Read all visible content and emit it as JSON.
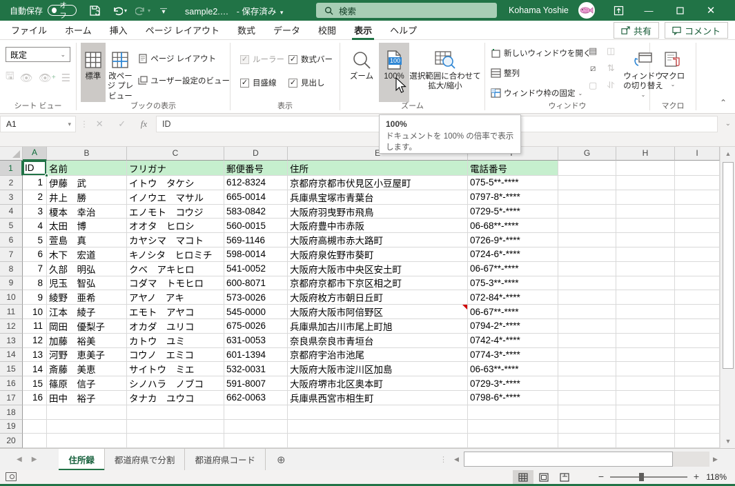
{
  "titlebar": {
    "autosave_label": "自動保存",
    "autosave_state": "オフ",
    "document_title": "sample2.…",
    "save_status": "- 保存済み",
    "search_placeholder": "検索",
    "user_name": "Kohama Yoshie"
  },
  "ribbon_tabs": {
    "items": [
      {
        "label": "ファイル"
      },
      {
        "label": "ホーム"
      },
      {
        "label": "挿入"
      },
      {
        "label": "ページ レイアウト"
      },
      {
        "label": "数式"
      },
      {
        "label": "データ"
      },
      {
        "label": "校閲"
      },
      {
        "label": "表示"
      },
      {
        "label": "ヘルプ"
      }
    ],
    "active": "表示",
    "share_label": "共有",
    "comments_label": "コメント"
  },
  "ribbon": {
    "sheet_view": {
      "dropdown_value": "既定",
      "group_label": "シート ビュー"
    },
    "workbook_views": {
      "normal": "標準",
      "page_break_preview": "改ページ プレビュー",
      "page_layout": "ページ レイアウト",
      "custom_views": "ユーザー設定のビュー",
      "group_label": "ブックの表示"
    },
    "show": {
      "ruler": "ルーラー",
      "formula_bar": "数式バー",
      "gridlines": "目盛線",
      "headings": "見出し",
      "group_label": "表示"
    },
    "zoom": {
      "zoom": "ズーム",
      "hundred": "100%",
      "badge": "100",
      "fit_selection": "選択範囲に合わせて拡大/縮小",
      "group_label": "ズーム"
    },
    "window": {
      "new_window": "新しいウィンドウを開く",
      "arrange": "整列",
      "freeze_panes": "ウィンドウ枠の固定",
      "switch_windows": "ウィンドウの切り替え",
      "group_label": "ウィンドウ"
    },
    "macros": {
      "label": "マクロ",
      "group_label": "マクロ"
    }
  },
  "tooltip": {
    "title": "100%",
    "body": "ドキュメントを 100% の倍率で表示します。"
  },
  "formula_bar": {
    "name_box": "A1",
    "fx_label": "fx",
    "content": "ID"
  },
  "sheet": {
    "columns": [
      "A",
      "B",
      "C",
      "D",
      "E",
      "F",
      "G",
      "H",
      "I"
    ],
    "header_row": [
      "ID",
      "名前",
      "フリガナ",
      "郵便番号",
      "住所",
      "電話番号"
    ],
    "rows": [
      [
        "1",
        "伊藤　武",
        "イトウ　タケシ",
        "612-8324",
        "京都府京都市伏見区小豆屋町",
        "075-5**-****"
      ],
      [
        "2",
        "井上　勝",
        "イノウエ　マサル",
        "665-0014",
        "兵庫県宝塚市青葉台",
        "0797-8*-****"
      ],
      [
        "3",
        "榎本　幸治",
        "エノモト　コウジ",
        "583-0842",
        "大阪府羽曳野市飛鳥",
        "0729-5*-****"
      ],
      [
        "4",
        "太田　博",
        "オオタ　ヒロシ",
        "560-0015",
        "大阪府豊中市赤阪",
        "06-68**-****"
      ],
      [
        "5",
        "萱島　真",
        "カヤシマ　マコト",
        "569-1146",
        "大阪府高槻市赤大路町",
        "0726-9*-****"
      ],
      [
        "6",
        "木下　宏道",
        "キノシタ　ヒロミチ",
        "598-0014",
        "大阪府泉佐野市葵町",
        "0724-6*-****"
      ],
      [
        "7",
        "久部　明弘",
        "クベ　アキヒロ",
        "541-0052",
        "大阪府大阪市中央区安土町",
        "06-67**-****"
      ],
      [
        "8",
        "児玉　智弘",
        "コダマ　トモヒロ",
        "600-8071",
        "京都府京都市下京区相之町",
        "075-3**-****"
      ],
      [
        "9",
        "綾野　亜希",
        "アヤノ　アキ",
        "573-0026",
        "大阪府枚方市朝日丘町",
        "072-84*-****"
      ],
      [
        "10",
        "江本　綾子",
        "エモト　アヤコ",
        "545-0000",
        "大阪府大阪市阿倍野区",
        "06-67**-****"
      ],
      [
        "11",
        "岡田　優梨子",
        "オカダ　ユリコ",
        "675-0026",
        "兵庫県加古川市尾上町旭",
        "0794-2*-****"
      ],
      [
        "12",
        "加藤　裕美",
        "カトウ　ユミ",
        "631-0053",
        "奈良県奈良市青垣台",
        "0742-4*-****"
      ],
      [
        "13",
        "河野　恵美子",
        "コウノ　エミコ",
        "601-1394",
        "京都府宇治市池尾",
        "0774-3*-****"
      ],
      [
        "14",
        "斎藤　美恵",
        "サイトウ　ミエ",
        "532-0031",
        "大阪府大阪市淀川区加島",
        "06-63**-****"
      ],
      [
        "15",
        "篠原　信子",
        "シノハラ　ノブコ",
        "591-8007",
        "大阪府堺市北区奥本町",
        "0729-3*-****"
      ],
      [
        "16",
        "田中　裕子",
        "タナカ　ユウコ",
        "662-0063",
        "兵庫県西宮市相生町",
        "0798-6*-****"
      ]
    ],
    "visible_row_count": 20,
    "selected_cell": "A1",
    "comment_marker_cell": "E11"
  },
  "sheet_tabs": {
    "items": [
      {
        "label": "住所録"
      },
      {
        "label": "都道府県で分割"
      },
      {
        "label": "都道府県コード"
      }
    ],
    "active": "住所録"
  },
  "status_bar": {
    "zoom_percent": "118%"
  },
  "colors": {
    "excel_green": "#217346",
    "header_fill": "#c6efce",
    "badge_blue": "#2e86d4"
  }
}
